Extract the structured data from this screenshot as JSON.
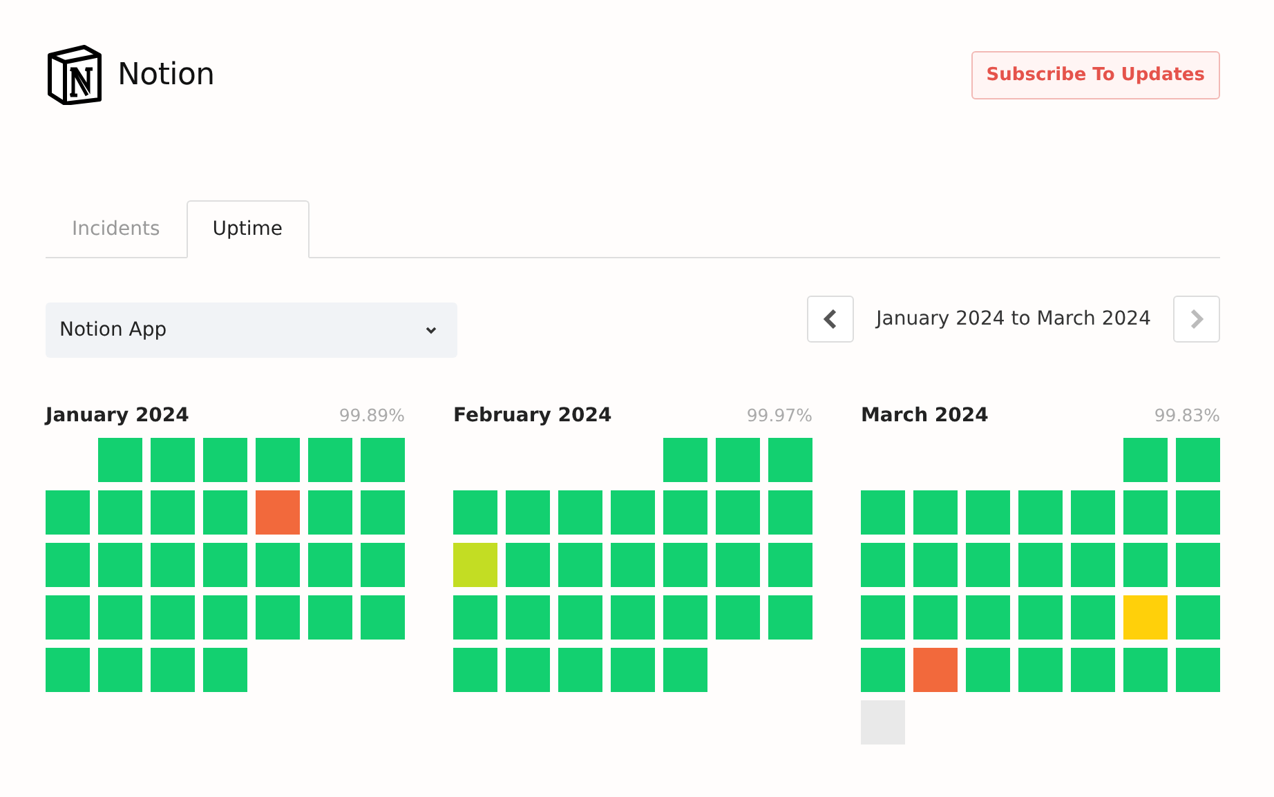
{
  "header": {
    "brand": "Notion",
    "subscribe_button": "Subscribe To Updates"
  },
  "tabs": [
    {
      "label": "Incidents",
      "selected": false
    },
    {
      "label": "Uptime",
      "selected": true
    }
  ],
  "component_select": {
    "value": "Notion App"
  },
  "range_nav": {
    "label": "January 2024 to March 2024",
    "prev_disabled": false,
    "next_disabled": true
  },
  "months": [
    {
      "title": "January 2024",
      "uptime": "99.89%",
      "days": [
        {
          "kind": "blank"
        },
        {
          "kind": "day",
          "color": "#13d070"
        },
        {
          "kind": "day",
          "color": "#13d070"
        },
        {
          "kind": "day",
          "color": "#13d070"
        },
        {
          "kind": "day",
          "color": "#13d070"
        },
        {
          "kind": "day",
          "color": "#13d070"
        },
        {
          "kind": "day",
          "color": "#13d070"
        },
        {
          "kind": "day",
          "color": "#13d070"
        },
        {
          "kind": "day",
          "color": "#13d070"
        },
        {
          "kind": "day",
          "color": "#13d070"
        },
        {
          "kind": "day",
          "color": "#13d070"
        },
        {
          "kind": "day",
          "color": "#f2693c"
        },
        {
          "kind": "day",
          "color": "#13d070"
        },
        {
          "kind": "day",
          "color": "#13d070"
        },
        {
          "kind": "day",
          "color": "#13d070"
        },
        {
          "kind": "day",
          "color": "#13d070"
        },
        {
          "kind": "day",
          "color": "#13d070"
        },
        {
          "kind": "day",
          "color": "#13d070"
        },
        {
          "kind": "day",
          "color": "#13d070"
        },
        {
          "kind": "day",
          "color": "#13d070"
        },
        {
          "kind": "day",
          "color": "#13d070"
        },
        {
          "kind": "day",
          "color": "#13d070"
        },
        {
          "kind": "day",
          "color": "#13d070"
        },
        {
          "kind": "day",
          "color": "#13d070"
        },
        {
          "kind": "day",
          "color": "#13d070"
        },
        {
          "kind": "day",
          "color": "#13d070"
        },
        {
          "kind": "day",
          "color": "#13d070"
        },
        {
          "kind": "day",
          "color": "#13d070"
        },
        {
          "kind": "day",
          "color": "#13d070"
        },
        {
          "kind": "day",
          "color": "#13d070"
        },
        {
          "kind": "day",
          "color": "#13d070"
        },
        {
          "kind": "day",
          "color": "#13d070"
        }
      ]
    },
    {
      "title": "February 2024",
      "uptime": "99.97%",
      "days": [
        {
          "kind": "blank"
        },
        {
          "kind": "blank"
        },
        {
          "kind": "blank"
        },
        {
          "kind": "blank"
        },
        {
          "kind": "day",
          "color": "#13d070"
        },
        {
          "kind": "day",
          "color": "#13d070"
        },
        {
          "kind": "day",
          "color": "#13d070"
        },
        {
          "kind": "day",
          "color": "#13d070"
        },
        {
          "kind": "day",
          "color": "#13d070"
        },
        {
          "kind": "day",
          "color": "#13d070"
        },
        {
          "kind": "day",
          "color": "#13d070"
        },
        {
          "kind": "day",
          "color": "#13d070"
        },
        {
          "kind": "day",
          "color": "#13d070"
        },
        {
          "kind": "day",
          "color": "#13d070"
        },
        {
          "kind": "day",
          "color": "#c3dd23"
        },
        {
          "kind": "day",
          "color": "#13d070"
        },
        {
          "kind": "day",
          "color": "#13d070"
        },
        {
          "kind": "day",
          "color": "#13d070"
        },
        {
          "kind": "day",
          "color": "#13d070"
        },
        {
          "kind": "day",
          "color": "#13d070"
        },
        {
          "kind": "day",
          "color": "#13d070"
        },
        {
          "kind": "day",
          "color": "#13d070"
        },
        {
          "kind": "day",
          "color": "#13d070"
        },
        {
          "kind": "day",
          "color": "#13d070"
        },
        {
          "kind": "day",
          "color": "#13d070"
        },
        {
          "kind": "day",
          "color": "#13d070"
        },
        {
          "kind": "day",
          "color": "#13d070"
        },
        {
          "kind": "day",
          "color": "#13d070"
        },
        {
          "kind": "day",
          "color": "#13d070"
        },
        {
          "kind": "day",
          "color": "#13d070"
        },
        {
          "kind": "day",
          "color": "#13d070"
        },
        {
          "kind": "day",
          "color": "#13d070"
        },
        {
          "kind": "day",
          "color": "#13d070"
        }
      ]
    },
    {
      "title": "March 2024",
      "uptime": "99.83%",
      "days": [
        {
          "kind": "blank"
        },
        {
          "kind": "blank"
        },
        {
          "kind": "blank"
        },
        {
          "kind": "blank"
        },
        {
          "kind": "blank"
        },
        {
          "kind": "day",
          "color": "#13d070"
        },
        {
          "kind": "day",
          "color": "#13d070"
        },
        {
          "kind": "day",
          "color": "#13d070"
        },
        {
          "kind": "day",
          "color": "#13d070"
        },
        {
          "kind": "day",
          "color": "#13d070"
        },
        {
          "kind": "day",
          "color": "#13d070"
        },
        {
          "kind": "day",
          "color": "#13d070"
        },
        {
          "kind": "day",
          "color": "#13d070"
        },
        {
          "kind": "day",
          "color": "#13d070"
        },
        {
          "kind": "day",
          "color": "#13d070"
        },
        {
          "kind": "day",
          "color": "#13d070"
        },
        {
          "kind": "day",
          "color": "#13d070"
        },
        {
          "kind": "day",
          "color": "#13d070"
        },
        {
          "kind": "day",
          "color": "#13d070"
        },
        {
          "kind": "day",
          "color": "#13d070"
        },
        {
          "kind": "day",
          "color": "#13d070"
        },
        {
          "kind": "day",
          "color": "#13d070"
        },
        {
          "kind": "day",
          "color": "#13d070"
        },
        {
          "kind": "day",
          "color": "#13d070"
        },
        {
          "kind": "day",
          "color": "#13d070"
        },
        {
          "kind": "day",
          "color": "#13d070"
        },
        {
          "kind": "day",
          "color": "#ffd00a"
        },
        {
          "kind": "day",
          "color": "#13d070"
        },
        {
          "kind": "day",
          "color": "#13d070"
        },
        {
          "kind": "day",
          "color": "#f2693c"
        },
        {
          "kind": "day",
          "color": "#13d070"
        },
        {
          "kind": "day",
          "color": "#13d070"
        },
        {
          "kind": "day",
          "color": "#13d070"
        },
        {
          "kind": "day",
          "color": "#13d070"
        },
        {
          "kind": "day",
          "color": "#13d070"
        },
        {
          "kind": "day",
          "color": "#e9e9e9"
        }
      ]
    }
  ]
}
